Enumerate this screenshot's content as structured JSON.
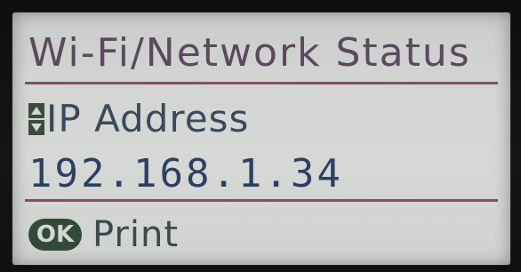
{
  "screen": {
    "title": "Wi-Fi/Network Status",
    "item_label": "IP Address",
    "item_value": "192.168.1.34",
    "ok_key": "OK",
    "ok_action": "Print"
  },
  "icons": {
    "scroll": "up-down-scroll-icon",
    "ok": "ok-button-icon"
  },
  "colors": {
    "lcd_background": "#d4d6d3",
    "title_text": "#5a4a5e",
    "value_text": "#2e3f66",
    "divider": "#7a3848",
    "ok_badge": "#334a39"
  }
}
